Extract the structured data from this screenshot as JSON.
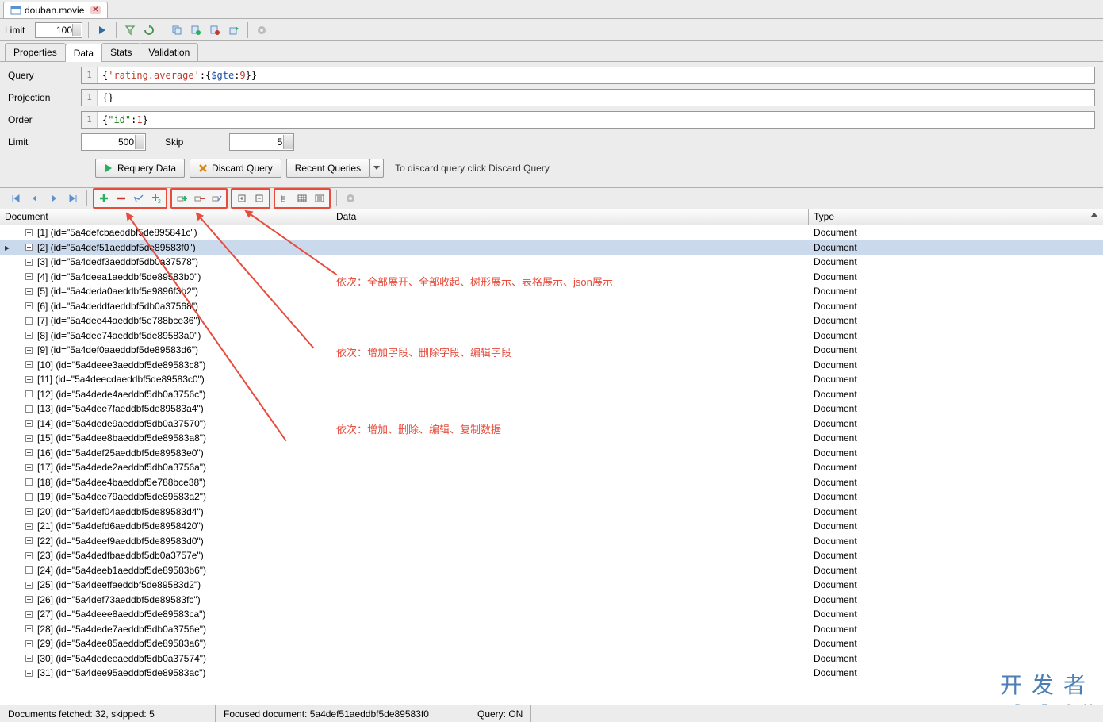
{
  "tab": {
    "title": "douban.movie"
  },
  "toolbar": {
    "limit_label": "Limit",
    "limit_value": "100"
  },
  "subtabs": [
    "Properties",
    "Data",
    "Stats",
    "Validation"
  ],
  "active_subtab": 1,
  "query_panel": {
    "query_label": "Query",
    "query_text": "{'rating.average':{$gte:9}}",
    "projection_label": "Projection",
    "projection_text": "{}",
    "order_label": "Order",
    "order_text": "{\"id\":1}",
    "limit_label": "Limit",
    "limit_value": "500",
    "skip_label": "Skip",
    "skip_value": "5",
    "gutter": "1"
  },
  "actions": {
    "requery": "Requery Data",
    "discard": "Discard Query",
    "recent": "Recent Queries",
    "hint": "To discard query click Discard Query"
  },
  "columns": {
    "document": "Document",
    "data": "Data",
    "type": "Type"
  },
  "type_label": "Document",
  "selected_row": 1,
  "rows": [
    {
      "label": "[1] (id=\"5a4defcbaeddbf5de895841c\")"
    },
    {
      "label": "[2] (id=\"5a4def51aeddbf5de89583f0\")"
    },
    {
      "label": "[3] (id=\"5a4dedf3aeddbf5db0a37578\")"
    },
    {
      "label": "[4] (id=\"5a4deea1aeddbf5de89583b0\")"
    },
    {
      "label": "[5] (id=\"5a4deda0aeddbf5e9896f3b2\")"
    },
    {
      "label": "[6] (id=\"5a4deddfaeddbf5db0a37568\")"
    },
    {
      "label": "[7] (id=\"5a4dee44aeddbf5e788bce36\")"
    },
    {
      "label": "[8] (id=\"5a4dee74aeddbf5de89583a0\")"
    },
    {
      "label": "[9] (id=\"5a4def0aaeddbf5de89583d6\")"
    },
    {
      "label": "[10] (id=\"5a4deee3aeddbf5de89583c8\")"
    },
    {
      "label": "[11] (id=\"5a4deecdaeddbf5de89583c0\")"
    },
    {
      "label": "[12] (id=\"5a4dede4aeddbf5db0a3756c\")"
    },
    {
      "label": "[13] (id=\"5a4dee7faeddbf5de89583a4\")"
    },
    {
      "label": "[14] (id=\"5a4dede9aeddbf5db0a37570\")"
    },
    {
      "label": "[15] (id=\"5a4dee8baeddbf5de89583a8\")"
    },
    {
      "label": "[16] (id=\"5a4def25aeddbf5de89583e0\")"
    },
    {
      "label": "[17] (id=\"5a4dede2aeddbf5db0a3756a\")"
    },
    {
      "label": "[18] (id=\"5a4dee4baeddbf5e788bce38\")"
    },
    {
      "label": "[19] (id=\"5a4dee79aeddbf5de89583a2\")"
    },
    {
      "label": "[20] (id=\"5a4def04aeddbf5de89583d4\")"
    },
    {
      "label": "[21] (id=\"5a4defd6aeddbf5de8958420\")"
    },
    {
      "label": "[22] (id=\"5a4deef9aeddbf5de89583d0\")"
    },
    {
      "label": "[23] (id=\"5a4dedfbaeddbf5db0a3757e\")"
    },
    {
      "label": "[24] (id=\"5a4deeb1aeddbf5de89583b6\")"
    },
    {
      "label": "[25] (id=\"5a4deeffaeddbf5de89583d2\")"
    },
    {
      "label": "[26] (id=\"5a4def73aeddbf5de89583fc\")"
    },
    {
      "label": "[27] (id=\"5a4deee8aeddbf5de89583ca\")"
    },
    {
      "label": "[28] (id=\"5a4dede7aeddbf5db0a3756e\")"
    },
    {
      "label": "[29] (id=\"5a4dee85aeddbf5de89583a6\")"
    },
    {
      "label": "[30] (id=\"5a4dedeeaeddbf5db0a37574\")"
    },
    {
      "label": "[31] (id=\"5a4dee95aeddbf5de89583ac\")"
    }
  ],
  "annotations": {
    "a1": "依次：全部展开、全部收起、树形展示、表格展示、json展示",
    "a2": "依次：增加字段、删除字段、编辑字段",
    "a3": "依次：增加、删除、编辑、复制数据"
  },
  "status": {
    "fetched": "Documents fetched: 32, skipped: 5",
    "focused": "Focused document: 5a4def51aeddbf5de89583f0",
    "query": "Query: ON"
  },
  "watermark": {
    "main": "开发者",
    "sub": "DevZe.CoM"
  }
}
